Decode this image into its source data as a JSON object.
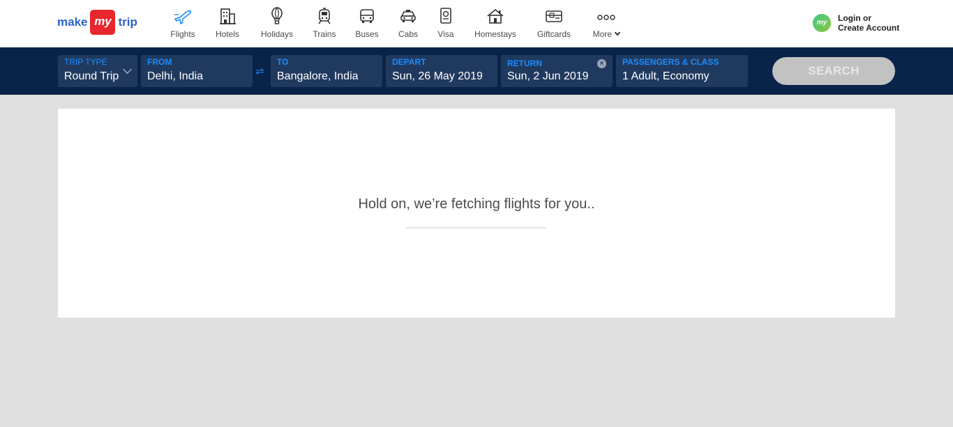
{
  "logo": {
    "make": "make",
    "my": "my",
    "trip": "trip"
  },
  "nav": [
    {
      "label": "Flights",
      "icon": "airplane-icon",
      "active": true
    },
    {
      "label": "Hotels",
      "icon": "hotel-building-icon"
    },
    {
      "label": "Holidays",
      "icon": "hot-air-balloon-icon"
    },
    {
      "label": "Trains",
      "icon": "train-icon"
    },
    {
      "label": "Buses",
      "icon": "bus-icon"
    },
    {
      "label": "Cabs",
      "icon": "car-icon"
    },
    {
      "label": "Visa",
      "icon": "passport-icon"
    },
    {
      "label": "Homestays",
      "icon": "house-icon"
    },
    {
      "label": "Giftcards",
      "icon": "giftcard-icon"
    },
    {
      "label": "More",
      "icon": "more-dots-icon"
    }
  ],
  "login": {
    "avatar_text": "my",
    "line1": "Login or",
    "line2": "Create Account"
  },
  "search": {
    "trip_type": {
      "label": "TRIP TYPE",
      "value": "Round Trip"
    },
    "from": {
      "label": "FROM",
      "value": "Delhi, India"
    },
    "swap_glyph": "⇌",
    "to": {
      "label": "TO",
      "value": "Bangalore, India"
    },
    "depart": {
      "label": "DEPART",
      "value": "Sun, 26 May 2019"
    },
    "return": {
      "label": "RETURN",
      "value": "Sun, 2 Jun 2019",
      "clear_glyph": "×"
    },
    "passengers": {
      "label": "PASSENGERS & CLASS",
      "value": "1 Adult, Economy"
    },
    "button": "SEARCH"
  },
  "loading": {
    "message": "Hold on, we’re fetching flights for you..",
    "progress": 0
  },
  "colors": {
    "brand_blue": "#2a64c5",
    "brand_red": "#e8262d",
    "searchbar_bg": "#0a2348",
    "field_bg": "#203a5f",
    "label_blue": "#1b8cff",
    "search_button_disabled": "#c2c2c2",
    "page_bg": "#e0e0e0"
  }
}
